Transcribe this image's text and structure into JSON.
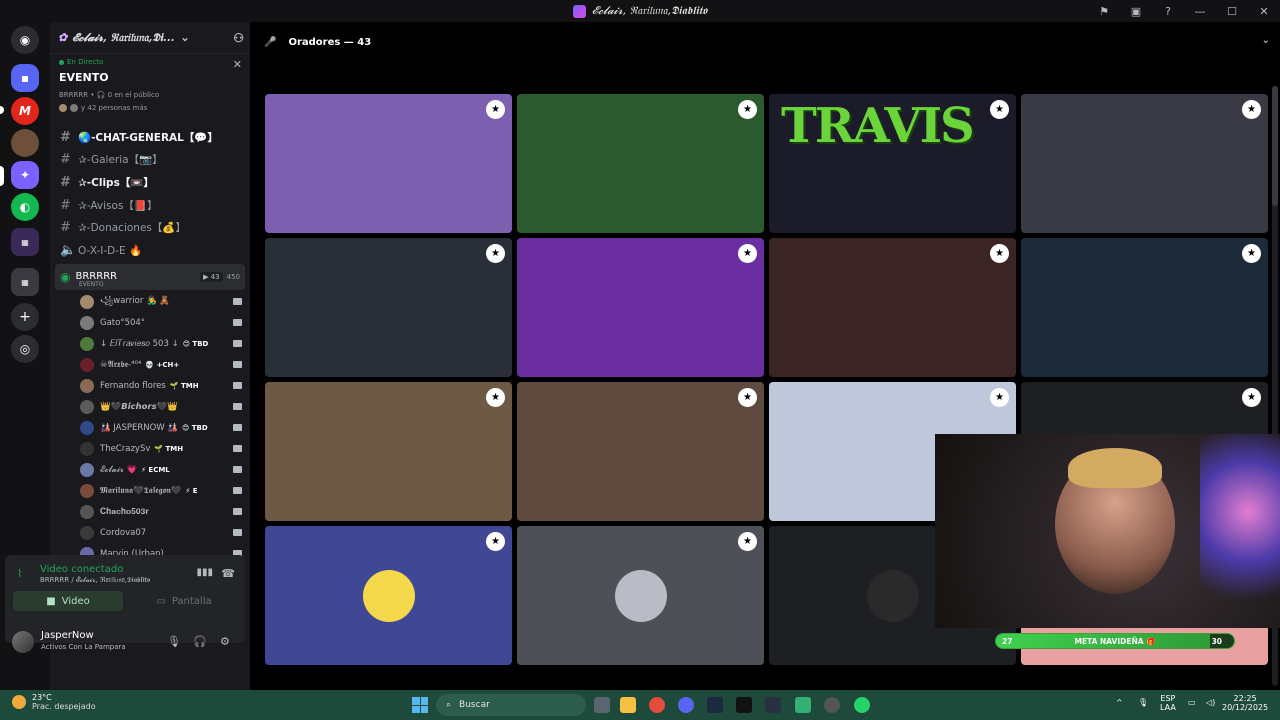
{
  "window": {
    "title": "𝓔𝓬𝓵𝓪𝓲𝓻, ℜ𝔞𝔯𝔦𝔩𝔲𝔫𝔞,𝕯𝖎𝖆𝖇𝖑𝖎𝖙𝖔",
    "controls": [
      "minimize",
      "maximize",
      "close"
    ]
  },
  "rail": {
    "servers": [
      {
        "icon": "discord-icon",
        "color": "#5865f2"
      },
      {
        "icon": "folder-icon",
        "color": "#5865f2"
      },
      {
        "icon": "server-red",
        "color": "#e1261c"
      },
      {
        "icon": "server-avatar",
        "color": "#6d4f3a"
      },
      {
        "icon": "server-active",
        "color": "#7b61ff"
      },
      {
        "icon": "server-green",
        "color": "#14b851"
      },
      {
        "icon": "server-multi",
        "color": "#6a3fb3"
      },
      {
        "icon": "server-folder",
        "color": "#3a3a40",
        "badge": "12"
      },
      {
        "icon": "add-server-icon",
        "color": "#2b2d31"
      },
      {
        "icon": "explore-icon",
        "color": "#2b2d31"
      }
    ]
  },
  "sidebar": {
    "server_name": "𝓔𝓬𝓵𝓪𝓲𝓻, ℜ𝔞𝔯𝔦𝔩𝔲𝔫𝔞,𝕯𝖎...",
    "event": {
      "live_label": "En Directo",
      "title": "EVENTO",
      "host_line": "BRRRRR • 🎧 0 en el público",
      "people_line": "y 42 personas más"
    },
    "channels": [
      {
        "label": "🌏-CHAT-GENERAL【💬】",
        "bold": true
      },
      {
        "label": "✰-Galeria【📷】",
        "bold": false
      },
      {
        "label": "✰-Clips【📼】",
        "bold": true
      },
      {
        "label": "✰-Avisos【📕】",
        "bold": false
      },
      {
        "label": "✰-Donaciones【💰】",
        "bold": false
      },
      {
        "label": "O-X-I-D-E 🔥",
        "bold": false,
        "voice": true
      }
    ],
    "voice_channel": {
      "name": "BRRRRR",
      "sub": "EVENTO",
      "cam_count": "43",
      "capacity": "450"
    },
    "members": [
      {
        "name": "꧁warrior 👨‍🎤 🧸",
        "tag": "",
        "color": "#a58a6d"
      },
      {
        "name": "Gato°504°",
        "tag": "",
        "color": "#7b7b7b"
      },
      {
        "name": "↓ 𝐸𝑙𝑇𝑟𝑎𝑣𝑖𝑒𝑠𝑜 503 ↓",
        "tag": "😊 TBD",
        "color": "#4f7a3a"
      },
      {
        "name": "☠𝕬𝖗𝖝𝖇𝖊-⁴⁰⁴",
        "tag": "💀 +CH+",
        "color": "#6b1f2b"
      },
      {
        "name": "Fernando flores",
        "tag": "🌱 TMH",
        "color": "#8a6a54"
      },
      {
        "name": "👑🖤𝘽𝙞𝙘𝙝𝙤𝙧𝙨🖤👑",
        "tag": "",
        "color": "#5a5a5a"
      },
      {
        "name": "🎎 JASPERNOW 🎎",
        "tag": "😊 TBD",
        "color": "#2f4a86"
      },
      {
        "name": "TheCrazySv",
        "tag": "🌱 TMH",
        "color": "#333"
      },
      {
        "name": "𝓔𝓬𝓵𝓪𝓲𝓻 💗",
        "tag": "⚡ ECML",
        "color": "#6a78a8"
      },
      {
        "name": "𝕸𝖆𝖗𝖎𝖑𝖚𝖓𝖆🖤𝕿𝖆𝖑𝖊𝖌𝖔𝖓🖤",
        "tag": "⚡ E",
        "color": "#7a4a3a"
      },
      {
        "name": "𝐂𝐡𝐚𝐜𝐡𝐨𝟓𝟎𝟑𝐫",
        "tag": "",
        "color": "#555"
      },
      {
        "name": "Cordova07",
        "tag": "",
        "color": "#3a3a3a"
      },
      {
        "name": "Marvin (Urban)",
        "tag": "",
        "color": "#6a6aa8"
      }
    ],
    "connection": {
      "status": "Video conectado",
      "location": "BRRRRR / 𝓔𝓬𝓵𝓪𝓲𝓻, ℜ𝔞𝔯𝔦𝔩𝔲𝔫𝔞,𝕯𝖎𝖆𝖇𝖑𝖎𝖙𝖔",
      "video_label": "Video",
      "screen_label": "Pantalla"
    },
    "user": {
      "name": "JasperNow",
      "status": "Activos Con La Pampara"
    }
  },
  "main": {
    "header": "Oradores — 43",
    "tiles": [
      {
        "bg": "#7d5fb0"
      },
      {
        "bg": "#2a5a2e"
      },
      {
        "bg": "#1b1b2a",
        "travis": "TRAVIS"
      },
      {
        "bg": "#3a3a44"
      },
      {
        "bg": "#2a2e38"
      },
      {
        "bg": "#6a2ea0"
      },
      {
        "bg": "#3a2424"
      },
      {
        "bg": "#1c2a3a"
      },
      {
        "bg": "#6e5a44"
      },
      {
        "bg": "#5e4a3e"
      },
      {
        "bg": "#bfc8da"
      },
      {
        "bg": "#1e1f22"
      },
      {
        "bg": "#404794",
        "avatar": "#f2d84a"
      },
      {
        "bg": "#4e5058",
        "avatar": "#b9bcc4"
      },
      {
        "bg": "#1e1f22",
        "avatar": "#2a2a2a"
      },
      {
        "bg": "#e8a0a0"
      }
    ],
    "overlay_goal": {
      "start": "27",
      "label": "META NAVIDEÑA 🎁",
      "end": "30",
      "progress": 0.9
    }
  },
  "taskbar": {
    "temperature": "23°C",
    "weather": "Prac. despejado",
    "search_placeholder": "Buscar",
    "lang_1": "ESP",
    "lang_2": "LAA",
    "time": "22:25",
    "date": "20/12/2025"
  }
}
